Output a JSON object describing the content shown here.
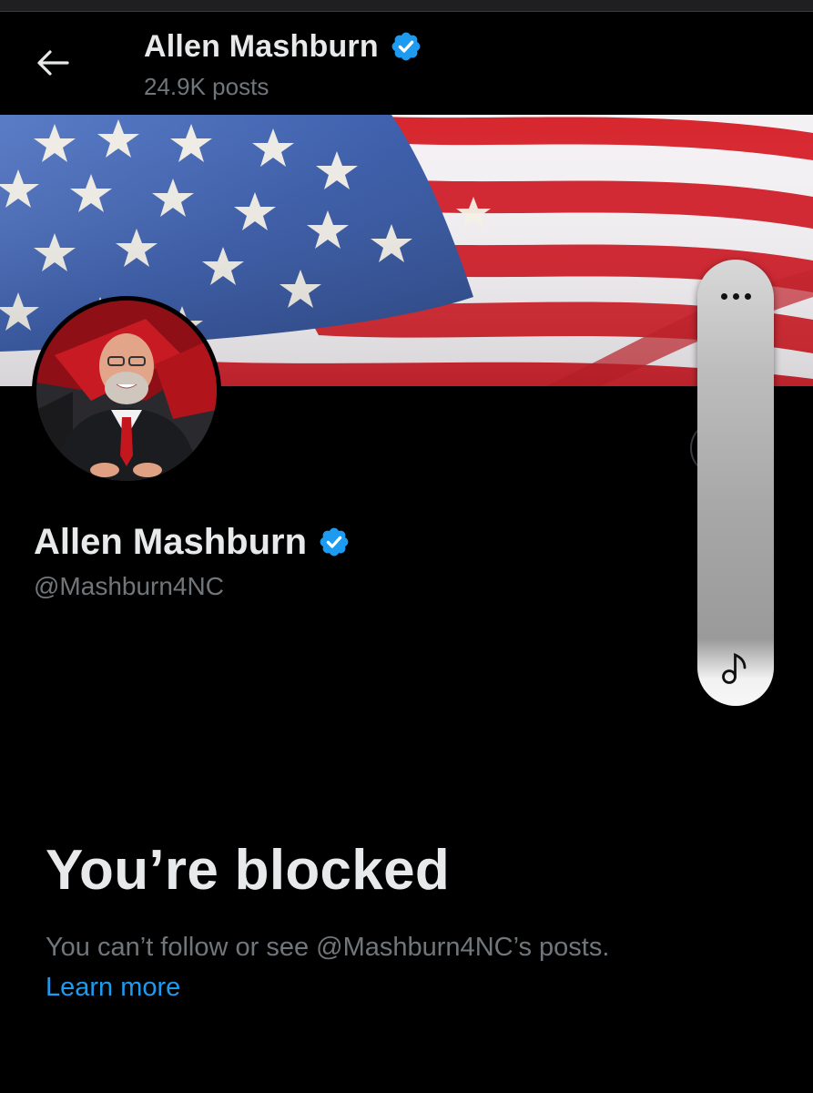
{
  "header": {
    "back_icon": "arrow-left-icon",
    "name": "Allen Mashburn",
    "verified_icon": "verified-badge-icon",
    "posts_count": "24.9K posts"
  },
  "profile": {
    "banner": "american-flag-banner",
    "avatar": "profile-photo",
    "name": "Allen Mashburn",
    "handle": "@Mashburn4NC",
    "verified_icon": "verified-badge-icon"
  },
  "blocked": {
    "title": "You’re blocked",
    "description": "You can’t follow or see @Mashburn4NC’s posts.",
    "learn_more": "Learn more"
  },
  "overlay": {
    "more_icon": "more-dots-icon",
    "music_icon": "music-note-icon"
  },
  "colors": {
    "background": "#000000",
    "primary_text": "#e7e9ea",
    "secondary_text": "#71767b",
    "link": "#1d9bf0",
    "verified": "#1d9bf0"
  }
}
